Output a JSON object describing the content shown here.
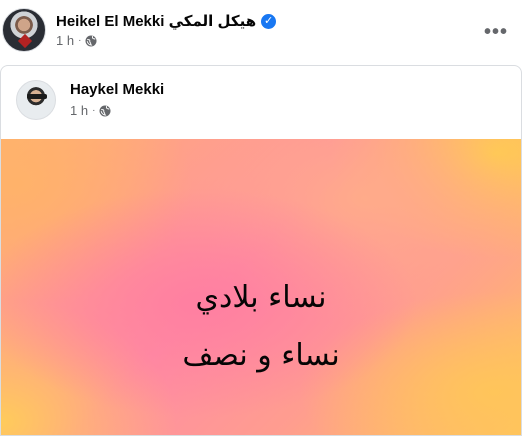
{
  "post": {
    "author": "Heikel El Mekki هيكل المكي",
    "time": "1 h",
    "separator": "·",
    "more": "•••"
  },
  "shared_post": {
    "author": "Haykel Mekki",
    "time": "1 h",
    "separator": "·",
    "text_lines": [
      "نساء بلادي",
      "نساء و نصف"
    ]
  },
  "icons": {
    "verified": "verified-badge-icon",
    "globe": "globe-icon",
    "more": "more-options-icon"
  },
  "colors": {
    "verified_blue": "#1877f2",
    "meta_gray": "#65676b"
  }
}
